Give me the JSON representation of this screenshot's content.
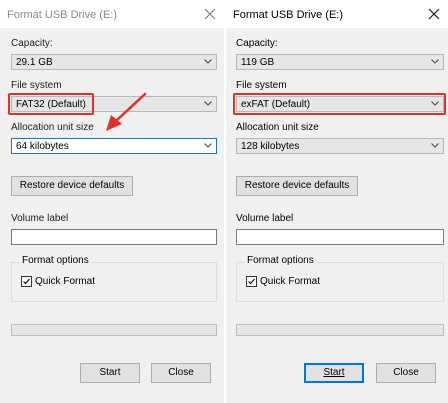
{
  "left_dialog": {
    "title": "Format USB Drive (E:)",
    "capacity_label": "Capacity:",
    "capacity_value": "29.1 GB",
    "filesystem_label": "File system",
    "filesystem_value": "FAT32 (Default)",
    "allocation_label": "Allocation unit size",
    "allocation_value": "64 kilobytes",
    "restore_label": "Restore device defaults",
    "volume_label": "Volume label",
    "volume_value": "",
    "format_options_label": "Format options",
    "quick_format_label": "Quick Format",
    "quick_format_checked": true,
    "progress": 0,
    "start_label": "Start",
    "close_label": "Close"
  },
  "right_dialog": {
    "title": "Format USB Drive (E:)",
    "capacity_label": "Capacity:",
    "capacity_value": "119 GB",
    "filesystem_label": "File system",
    "filesystem_value": "exFAT (Default)",
    "allocation_label": "Allocation unit size",
    "allocation_value": "128 kilobytes",
    "restore_label": "Restore device defaults",
    "volume_label": "Volume label",
    "volume_value": "",
    "format_options_label": "Format options",
    "quick_format_label": "Quick Format",
    "quick_format_checked": true,
    "progress": 0,
    "start_label": "Start",
    "close_label": "Close"
  },
  "icons": {
    "close": "close-icon",
    "dropdown": "chevron-down-icon",
    "check": "checkmark-icon"
  },
  "colors": {
    "highlight": "#e0302a",
    "focus_border": "#1a73c9",
    "default_button_border": "#0078d7",
    "dialog_bg": "#f0f0f0"
  }
}
